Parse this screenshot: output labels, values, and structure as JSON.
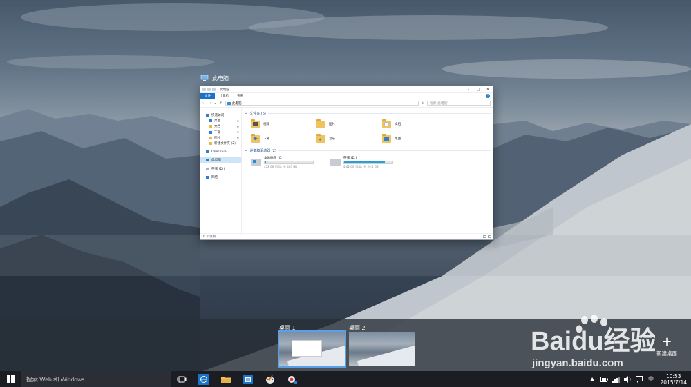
{
  "window": {
    "title": "此电脑",
    "breadcrumb": "此电脑",
    "ribbon_tabs": [
      "文件",
      "计算机",
      "查看"
    ],
    "search_placeholder": "搜索\"此电脑\"",
    "nav_items": [
      {
        "label": "快速访问",
        "icon": "star-icon"
      },
      {
        "label": "桌面",
        "icon": "desktop-icon"
      },
      {
        "label": "文档",
        "icon": "documents-icon"
      },
      {
        "label": "下载",
        "icon": "download-icon"
      },
      {
        "label": "图片",
        "icon": "pictures-icon"
      },
      {
        "label": "新建文件夹 (2)",
        "icon": "folder-icon"
      },
      {
        "label": "OneDrive",
        "icon": "onedrive-icon"
      },
      {
        "label": "此电脑",
        "icon": "computer-icon"
      },
      {
        "label": "存储 (D:)",
        "icon": "drive-icon"
      },
      {
        "label": "网络",
        "icon": "network-icon"
      }
    ],
    "folders_header": "文件夹 (6)",
    "folders": [
      "视频",
      "图片",
      "文档",
      "下载",
      "音乐",
      "桌面"
    ],
    "drives_header": "设备和驱动器 (2)",
    "drives": [
      {
        "name": "本地磁盘 (C:)",
        "free": "452 GB 可用，共 465 GB",
        "used_fraction": 0.03
      },
      {
        "name": "存储 (D:)",
        "free": "4.62 GB 可用，共 29.4 GB",
        "used_fraction": 0.84
      }
    ],
    "status": "6 个项目"
  },
  "task_view": {
    "desktops": [
      {
        "label": "桌面 1",
        "active": true
      },
      {
        "label": "桌面 2",
        "active": false
      }
    ],
    "new_desktop_label": "新建桌面"
  },
  "watermark": {
    "text": "Baidu经验",
    "url_text": "jingyan.baidu.com"
  },
  "taskbar": {
    "search_placeholder": "搜索 Web 和 Windows",
    "ime": "中",
    "time": "10:53",
    "date": "2015/7/14"
  },
  "colors": {
    "accent": "#1a73c9",
    "taskbar": "#1b1d22",
    "drive_bar": "#26a0da"
  }
}
